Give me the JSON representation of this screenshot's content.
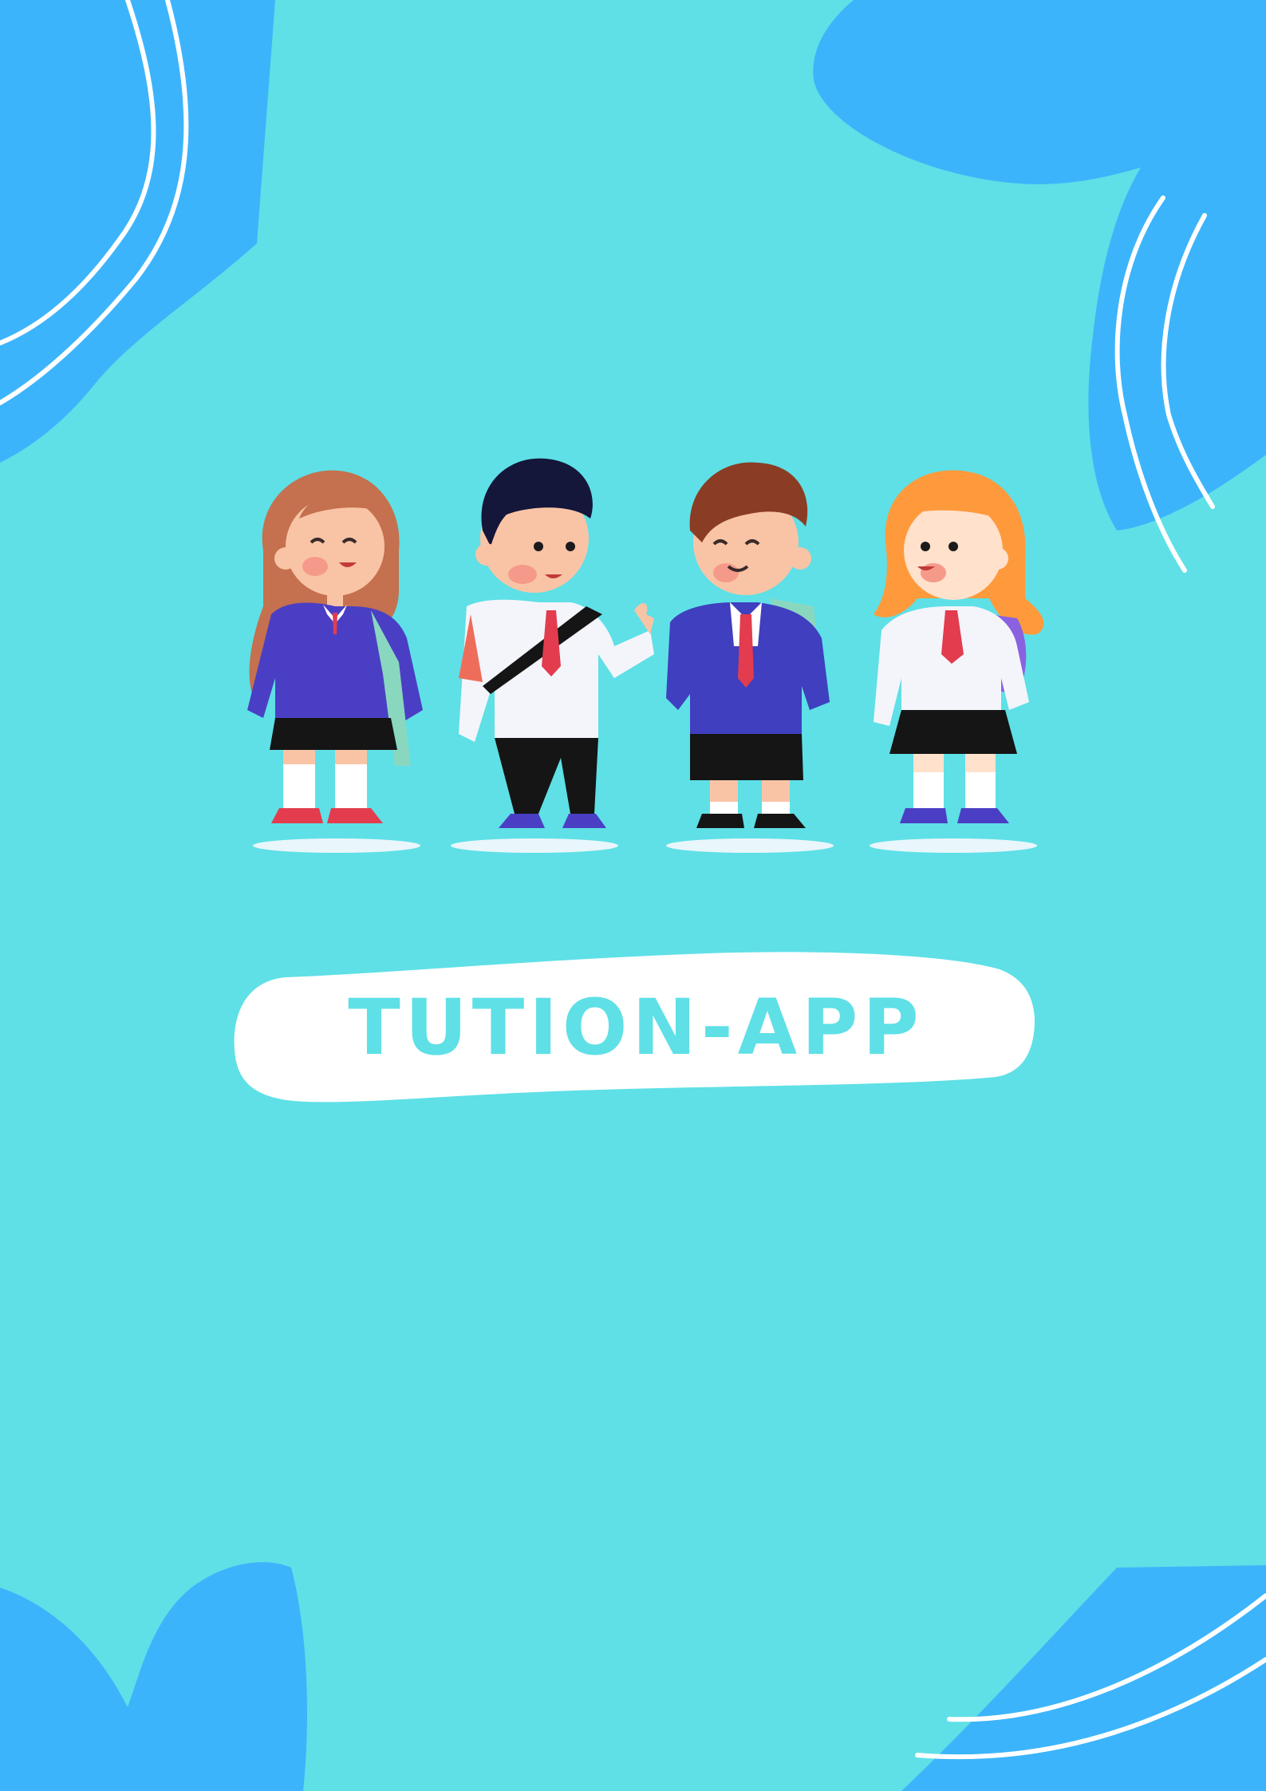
{
  "title": "TUTION-APP",
  "illustration": "four-school-children",
  "colors": {
    "background": "#5ee0e6",
    "blob": "#3cb4fb",
    "title_pill": "#ffffff",
    "title_text": "#5ee0e6"
  },
  "icons": [
    "abstract-blob-shape",
    "white-swirl-line"
  ]
}
